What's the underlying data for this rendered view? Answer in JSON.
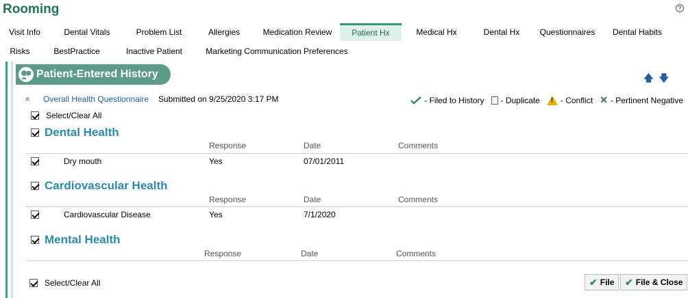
{
  "app": {
    "title": "Rooming",
    "help_icon": "?"
  },
  "tabs_row1": [
    {
      "label": "Visit Info"
    },
    {
      "label": "Dental Vitals"
    },
    {
      "label": "Problem List"
    },
    {
      "label": "Allergies"
    },
    {
      "label": "Medication Review"
    },
    {
      "label": "Patient Hx",
      "active": true
    },
    {
      "label": "Medical Hx"
    },
    {
      "label": "Dental Hx"
    },
    {
      "label": "Questionnaires"
    },
    {
      "label": "Dental Habits"
    }
  ],
  "tabs_row2": [
    {
      "label": "Risks"
    },
    {
      "label": "BestPractice"
    },
    {
      "label": "Inactive Patient"
    },
    {
      "label": "Marketing Communication Preferences"
    }
  ],
  "section": {
    "title": "Patient-Entered History",
    "up_arrow": "🡅",
    "down_arrow": "🡇"
  },
  "questionnaire": {
    "collapse_icon": "«",
    "link": "Overall Health Questionnaire",
    "submitted": "Submitted on 9/25/2020 3:17 PM"
  },
  "legend": {
    "filed": "- Filed to History",
    "duplicate": "- Duplicate",
    "conflict": "- Conflict",
    "negative": "- Pertinent Negative"
  },
  "select_all": "Select/Clear All",
  "columns": {
    "response": "Response",
    "date": "Date",
    "comments": "Comments"
  },
  "categories": [
    {
      "title": "Dental Health",
      "items": [
        {
          "name": "Dry mouth",
          "response": "Yes",
          "date": "07/01/2011",
          "comments": ""
        }
      ]
    },
    {
      "title": "Cardiovascular Health",
      "items": [
        {
          "name": "Cardiovascular Disease",
          "response": "Yes",
          "date": "7/1/2020",
          "comments": ""
        }
      ]
    },
    {
      "title": "Mental Health",
      "items": []
    }
  ],
  "buttons": {
    "file": "File",
    "file_close": "File & Close"
  },
  "colors": {
    "title_green": "#1c7a4c",
    "link_blue": "#1f5fa8",
    "category_blue": "#2a8cb5",
    "pill": "#5c9a8a"
  }
}
